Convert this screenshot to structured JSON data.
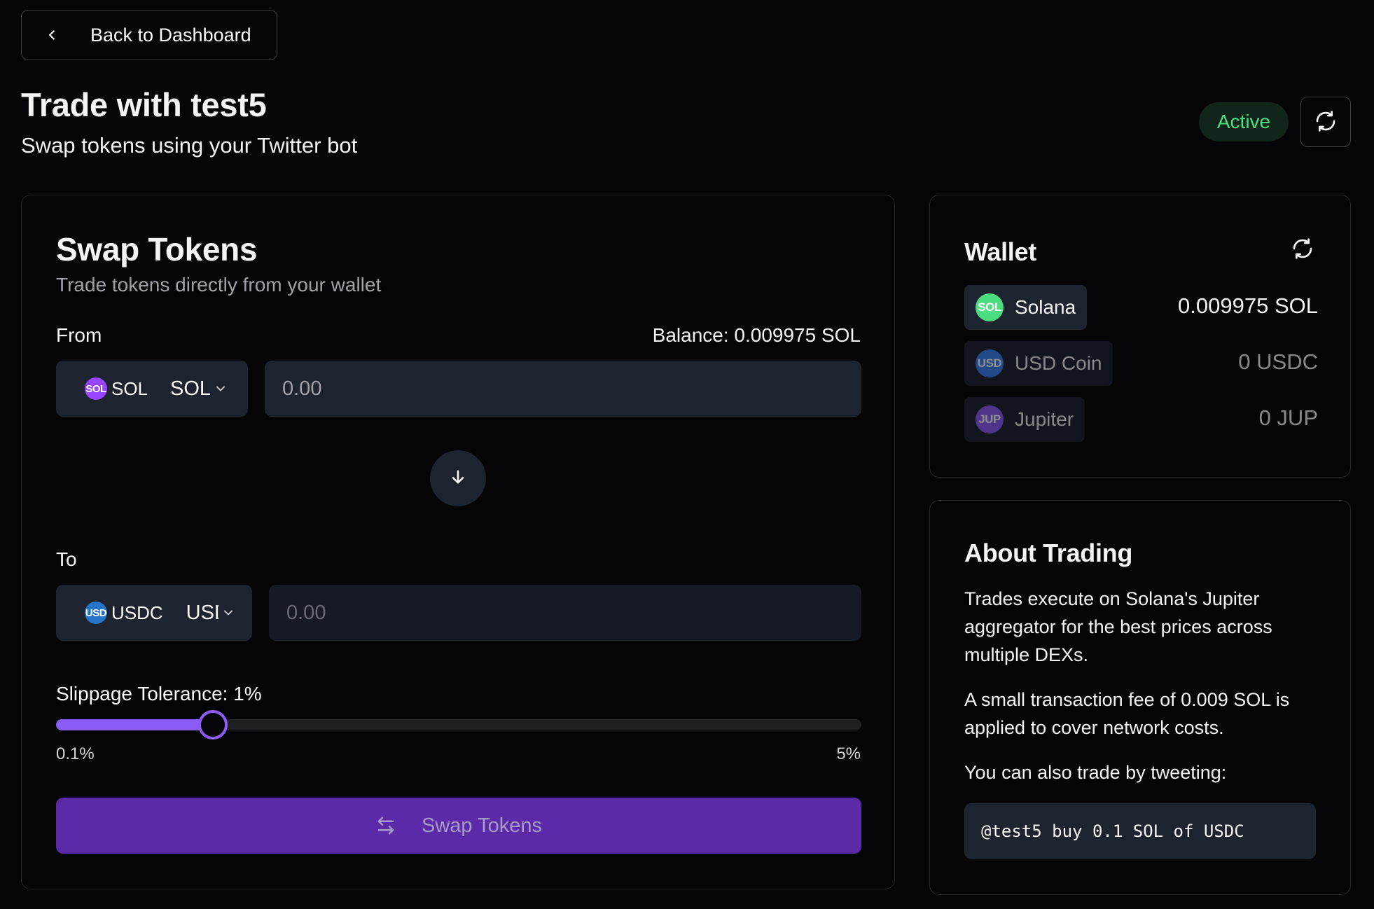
{
  "nav": {
    "back_label": "Back to Dashboard"
  },
  "header": {
    "title": "Trade with test5",
    "subtitle": "Swap tokens using your Twitter bot",
    "status": "Active",
    "status_color": "#4ade80"
  },
  "swap": {
    "title": "Swap Tokens",
    "subtitle": "Trade tokens directly from your wallet",
    "from_label": "From",
    "balance": "Balance: 0.009975 SOL",
    "from_token": {
      "icon_text": "SOL",
      "name": "SOL",
      "value": "SOL"
    },
    "from_placeholder": "0.00",
    "to_label": "To",
    "to_token": {
      "icon_text": "USD",
      "name": "USDC",
      "value": "USDC"
    },
    "to_placeholder": "0.00",
    "slippage_label": "Slippage Tolerance: 1%",
    "slippage_value": 1,
    "slippage_min": "0.1%",
    "slippage_max": "5%",
    "slippage_fill_fraction": 0.195,
    "submit_label": "Swap Tokens",
    "accent_color": "#8b5cf6"
  },
  "wallet": {
    "title": "Wallet",
    "rows": [
      {
        "icon_text": "SOL",
        "name": "Solana",
        "balance": "0.009975 SOL"
      },
      {
        "icon_text": "USD",
        "name": "USD Coin",
        "balance": "0 USDC"
      },
      {
        "icon_text": "JUP",
        "name": "Jupiter",
        "balance": "0 JUP"
      }
    ]
  },
  "about": {
    "title": "About Trading",
    "p1": "Trades execute on Solana's Jupiter aggregator for the best prices across multiple DEXs.",
    "p2": "A small transaction fee of 0.009 SOL is applied to cover network costs.",
    "p3": "You can also trade by tweeting:",
    "example": "@test5 buy 0.1 SOL of USDC"
  }
}
